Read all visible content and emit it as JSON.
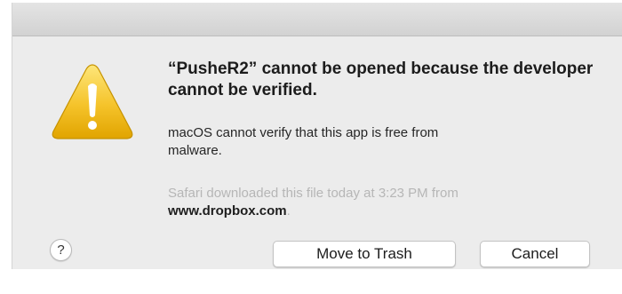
{
  "dialog": {
    "icon": "warning-triangle-icon",
    "title": "“PusheR2” cannot be opened because the developer cannot be verified.",
    "message": "macOS cannot verify that this app is free from malware.",
    "source_text": "Safari downloaded this file today at 3:23 PM from",
    "source_domain": "www.dropbox.com",
    "source_suffix": ".",
    "help_label": "?",
    "buttons": {
      "move_to_trash": "Move to Trash",
      "cancel": "Cancel"
    }
  },
  "colors": {
    "dialog_background": "#ececec",
    "warning_yellow": "#f7c52b",
    "secondary_text": "#b6b6b6"
  }
}
